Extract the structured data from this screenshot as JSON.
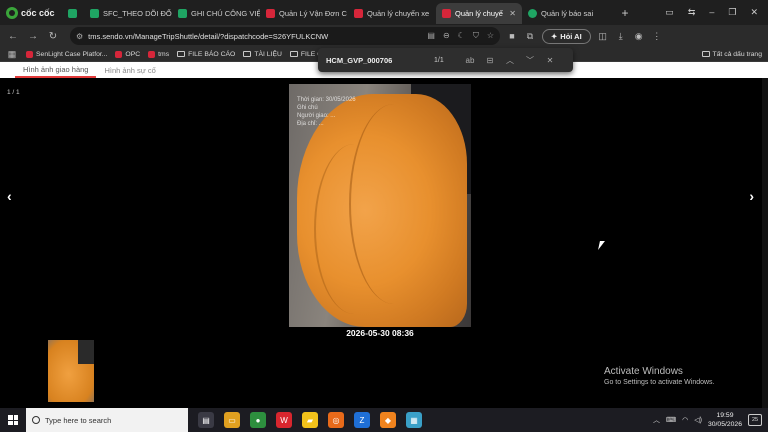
{
  "browser": {
    "brand": "cốc cốc",
    "tabs": [
      {
        "label": ""
      },
      {
        "label": "SFC_THEO DÕI ĐỔI"
      },
      {
        "label": "GHI CHÚ CÔNG VIỆ"
      },
      {
        "label": "Quản Lý Vận Đơn C"
      },
      {
        "label": "Quản lý chuyến xe"
      },
      {
        "label": "Quản lý chuyế"
      },
      {
        "label": "Quản lý báo sai"
      }
    ],
    "url": "tms.sendo.vn/ManageTripShuttle/detail/?dispatchcode=S26YFULKCNW",
    "hoi_ai": "Hỏi AI",
    "bookmarks": [
      "SenLight Case Platfor...",
      "OPC",
      "tms",
      "FILE BÁO CÁO",
      "TÀI LIỆU",
      "FILE CÔN"
    ],
    "all_bookmarks": "Tất cả dấu trang"
  },
  "find": {
    "query": "HCM_GVP_000706",
    "count": "1/1"
  },
  "page": {
    "tabs": [
      "Hình ảnh giao hàng",
      "Hình ảnh sự cố"
    ],
    "counter": "1 / 1",
    "prev": "‹",
    "next": "›",
    "caption": "2026-05-30 08:36",
    "watermark": [
      "Thời gian: 30/05/2026",
      "Ghi chú",
      "Người giao: ...",
      "Địa chỉ: ..."
    ]
  },
  "activate": {
    "title": "Activate Windows",
    "subtitle": "Go to Settings to activate Windows."
  },
  "taskbar": {
    "search_placeholder": "Type here to search",
    "time": "19:59",
    "date": "30/05/2026",
    "notifications": "25"
  }
}
